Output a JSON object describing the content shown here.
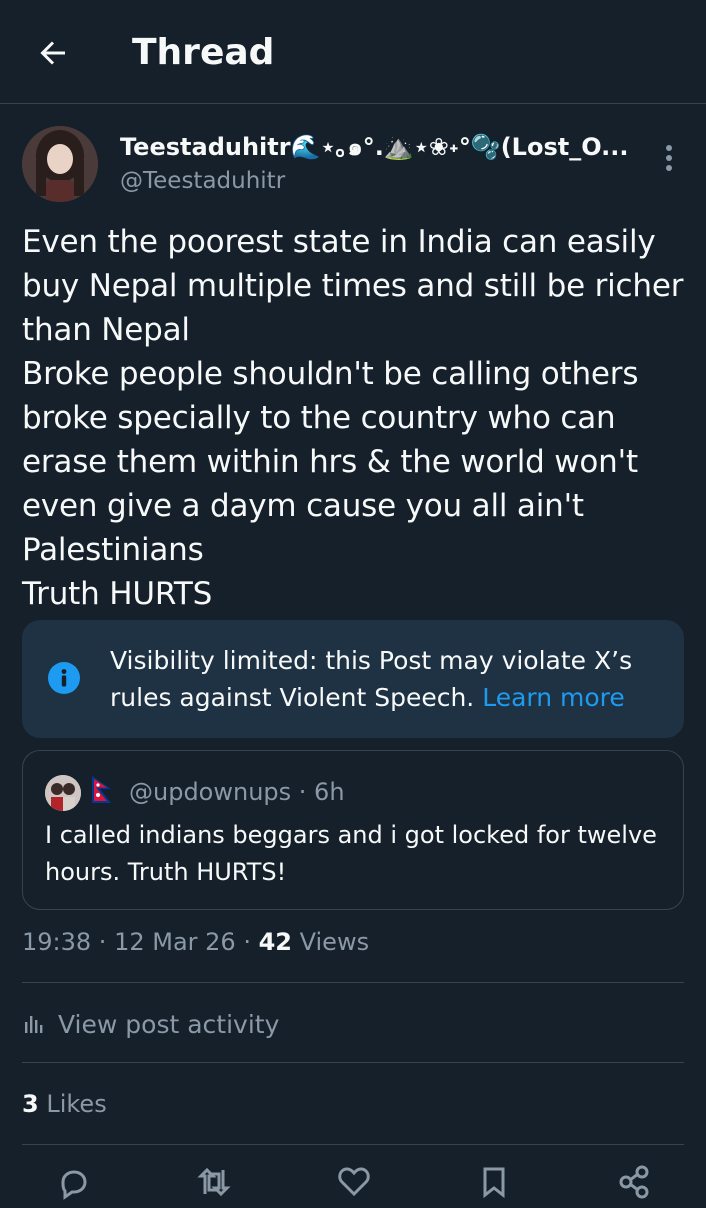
{
  "header": {
    "title": "Thread",
    "back_icon": "arrow-left-icon"
  },
  "post": {
    "author": {
      "display_name": "Teestaduhitr🌊⋆｡๑°.⛰️⋆❀˖°🫧(Lost_O...",
      "handle": "@Teestaduhitr"
    },
    "text": "Even the poorest state in India can easily buy Nepal multiple times and still be richer than Nepal\nBroke people shouldn't be calling others broke specially to the country who can erase them within hrs & the world won't even give a daym cause you all ain't Palestinians\nTruth HURTS",
    "notice": {
      "text": "Visibility limited: this Post may violate X’s rules against Violent Speech.",
      "link": "Learn more"
    },
    "quoted": {
      "handle": "@updownups",
      "time": "· 6h",
      "text": "I called indians beggars and i got locked for twelve hours. Truth HURTS!"
    },
    "meta": {
      "time": "19:38",
      "date": "12 Mar 26",
      "views_count": "42",
      "views_label": "Views"
    },
    "activity_label": "View post activity",
    "likes": {
      "count": "3",
      "label": "Likes"
    }
  },
  "colors": {
    "background": "#15202b",
    "text": "#f7f9f9",
    "secondary": "#8b98a5",
    "accent": "#1d9bf0",
    "notice_bg": "#1e3244",
    "border": "#38444d"
  }
}
